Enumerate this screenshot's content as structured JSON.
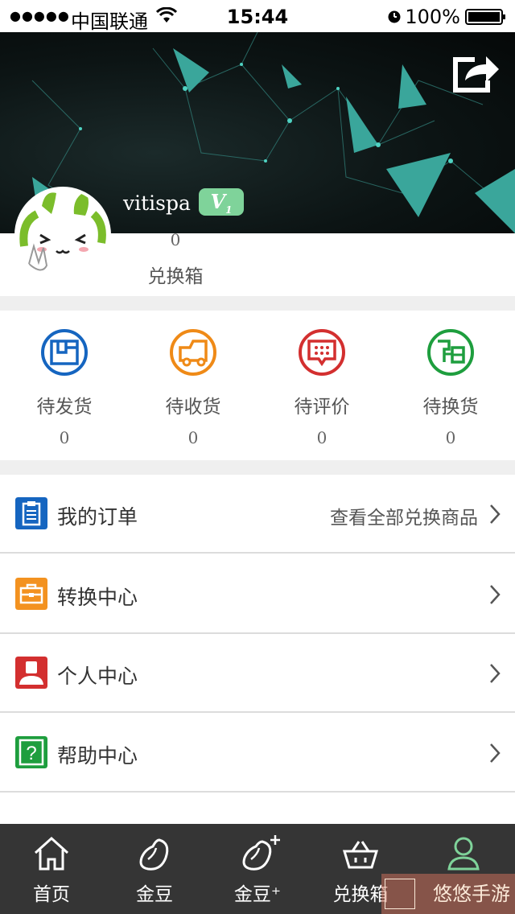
{
  "status_bar": {
    "carrier": "中国联通",
    "time": "15:44",
    "battery": "100%"
  },
  "profile": {
    "username": "vitispa",
    "level_badge": "V",
    "level_num": "1",
    "exchange_box_count": "0",
    "exchange_box_label": "兑换箱"
  },
  "order_status": [
    {
      "label": "待发货",
      "count": "0",
      "icon": "box-icon",
      "color": "#1565c0"
    },
    {
      "label": "待收货",
      "count": "0",
      "icon": "truck-icon",
      "color": "#ef8a17"
    },
    {
      "label": "待评价",
      "count": "0",
      "icon": "comment-icon",
      "color": "#d32f2f"
    },
    {
      "label": "待换货",
      "count": "0",
      "icon": "exchange-icon",
      "color": "#1e9e3e"
    }
  ],
  "menu": [
    {
      "label": "我的订单",
      "right_text": "查看全部兑换商品",
      "icon": "clipboard-icon",
      "color": "#1565c0"
    },
    {
      "label": "转换中心",
      "right_text": "",
      "icon": "briefcase-icon",
      "color": "#f39220"
    },
    {
      "label": "个人中心",
      "right_text": "",
      "icon": "person-icon",
      "color": "#d32f2f"
    },
    {
      "label": "帮助中心",
      "right_text": "",
      "icon": "help-icon",
      "color": "#1e9e3e"
    }
  ],
  "tabs": [
    {
      "label": "首页",
      "icon": "home-icon"
    },
    {
      "label": "金豆",
      "icon": "bean-icon"
    },
    {
      "label": "金豆⁺",
      "icon": "bean-plus-icon"
    },
    {
      "label": "兑换箱",
      "icon": "basket-icon"
    },
    {
      "label": "",
      "icon": "user-icon",
      "active": true
    }
  ],
  "watermark": "悠悠手游",
  "colors": {
    "accent": "#7fd39a",
    "tabbar": "#353535"
  }
}
